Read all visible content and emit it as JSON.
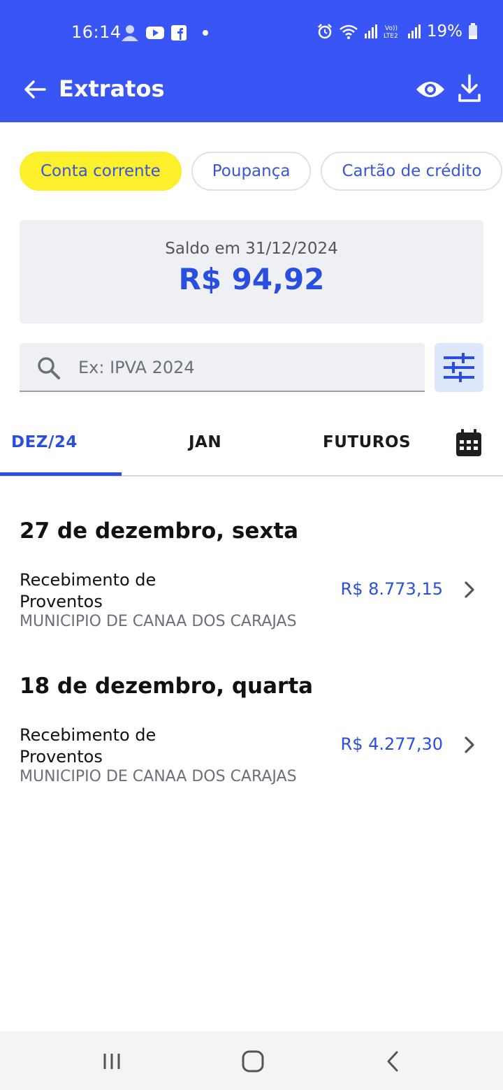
{
  "status_bar": {
    "time": "16:14",
    "battery": "19%",
    "icons_left": [
      "account-icon",
      "youtube-icon",
      "facebook-icon",
      "dot-icon"
    ],
    "icons_right": [
      "alarm-icon",
      "wifi-icon",
      "signal-icon",
      "volte-icon",
      "signal-icon",
      "battery-icon"
    ],
    "volte_label": "Vo))\nLTE2"
  },
  "header": {
    "title": "Extratos"
  },
  "chips": [
    {
      "label": "Conta corrente",
      "active": true
    },
    {
      "label": "Poupança",
      "active": false
    },
    {
      "label": "Cartão de crédito",
      "active": false
    }
  ],
  "balance": {
    "label": "Saldo em 31/12/2024",
    "value": "R$ 94,92"
  },
  "search": {
    "placeholder": "Ex: IPVA 2024",
    "value": ""
  },
  "tabs": [
    {
      "label": "DEZ/24",
      "active": true
    },
    {
      "label": "JAN",
      "active": false
    },
    {
      "label": "FUTUROS",
      "active": false
    }
  ],
  "transactions": [
    {
      "date": "27 de dezembro, sexta",
      "items": [
        {
          "name": "Recebimento de Proventos",
          "source": "MUNICIPIO DE CANAA DOS CARAJAS",
          "amount": "R$ 8.773,15"
        }
      ]
    },
    {
      "date": "18 de dezembro, quarta",
      "items": [
        {
          "name": "Recebimento de Proventos",
          "source": "MUNICIPIO DE CANAA DOS CARAJAS",
          "amount": "R$ 4.277,30"
        }
      ]
    }
  ],
  "colors": {
    "brand_blue": "#3a55f6",
    "accent_blue": "#2a4fe0",
    "chip_active": "#fbf02b"
  }
}
